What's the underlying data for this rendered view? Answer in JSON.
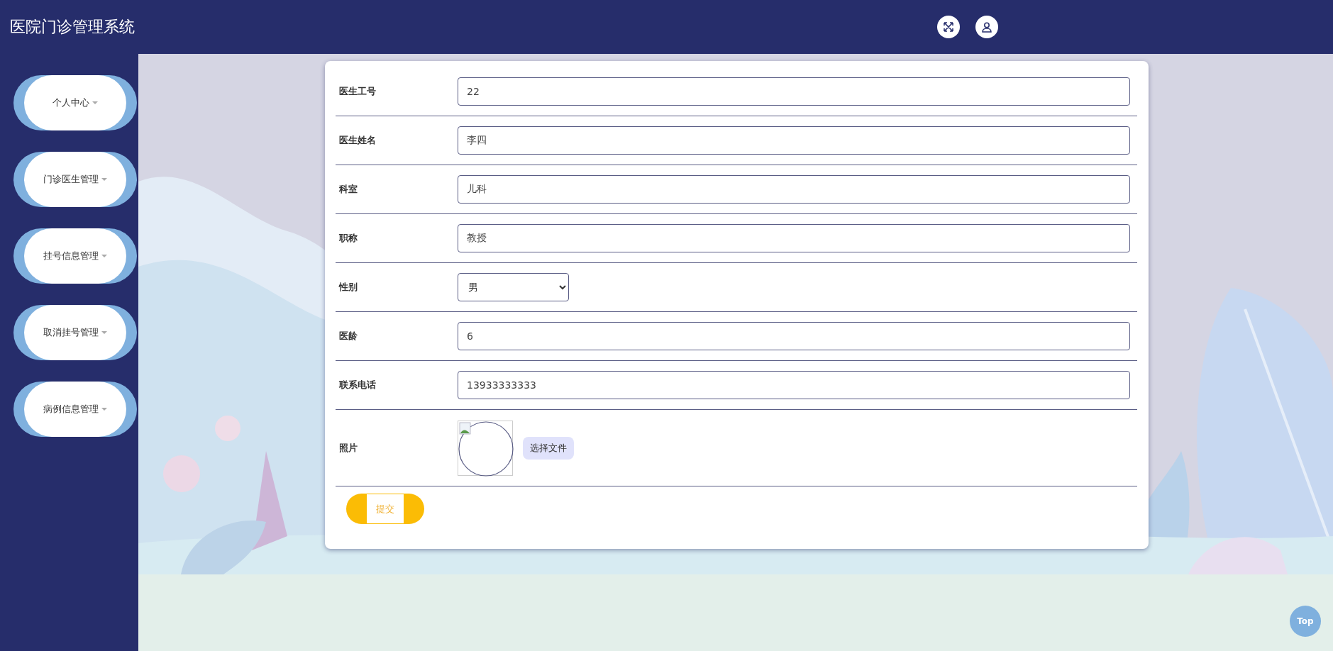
{
  "header": {
    "title": "医院门诊管理系统"
  },
  "sidebar": {
    "items": [
      {
        "label": "个人中心"
      },
      {
        "label": "门诊医生管理"
      },
      {
        "label": "挂号信息管理"
      },
      {
        "label": "取消挂号管理"
      },
      {
        "label": "病例信息管理"
      }
    ]
  },
  "form": {
    "fields": [
      {
        "kind": "text",
        "label": "医生工号",
        "value": "22"
      },
      {
        "kind": "text",
        "label": "医生姓名",
        "value": "李四"
      },
      {
        "kind": "text",
        "label": "科室",
        "value": "儿科"
      },
      {
        "kind": "text",
        "label": "职称",
        "value": "教授"
      },
      {
        "kind": "select",
        "label": "性别",
        "value": "男"
      },
      {
        "kind": "text",
        "label": "医龄",
        "value": "6"
      },
      {
        "kind": "text",
        "label": "联系电话",
        "value": "13933333333"
      },
      {
        "label": "照片",
        "button": "选择文件"
      }
    ],
    "submit": "提交"
  },
  "back_to_top": "Top"
}
